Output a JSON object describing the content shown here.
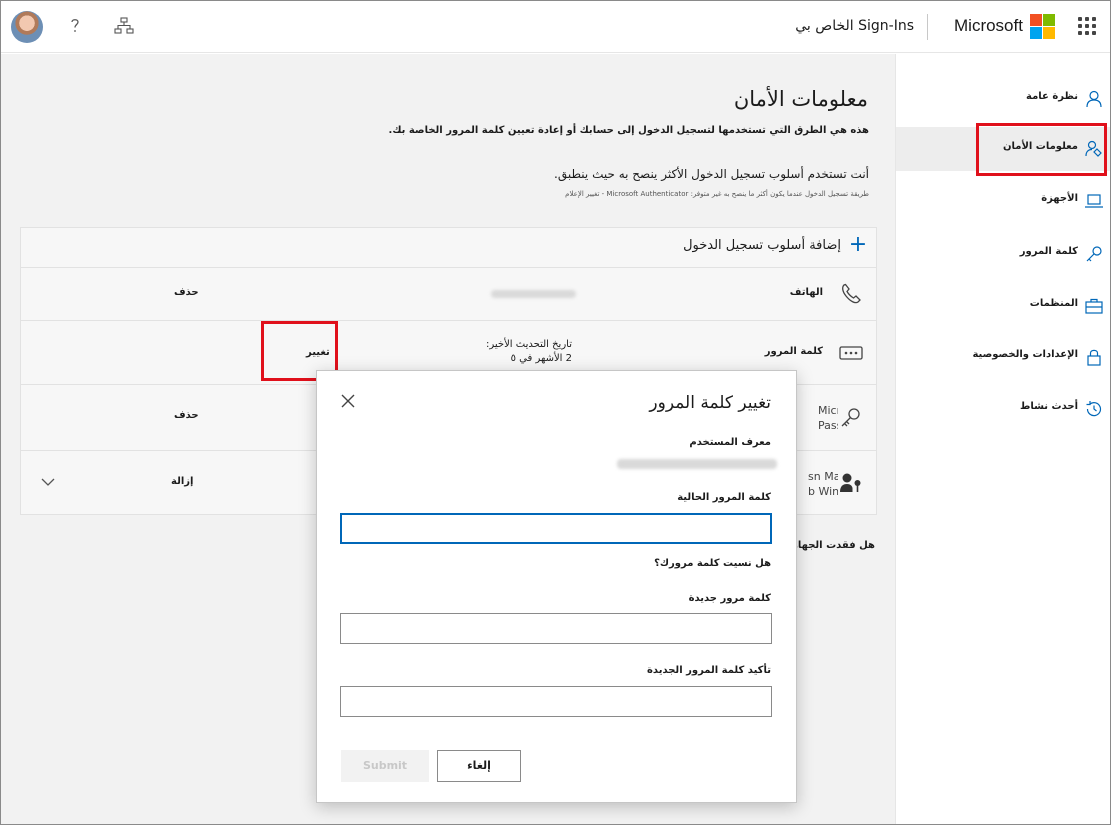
{
  "header": {
    "title": "Sign-Ins الخاص بي",
    "brand": "Microsoft",
    "icons": [
      "avatar",
      "help-icon",
      "org-chart-icon",
      "app-launcher-icon"
    ],
    "logo_colors": [
      "#f25022",
      "#7fba00",
      "#00a4ef",
      "#ffb900"
    ]
  },
  "sidebar": {
    "items": [
      {
        "label": "نظرة عامة",
        "icon": "person-icon",
        "active": false
      },
      {
        "label": "معلومات الأمان",
        "icon": "security-info-icon",
        "active": true
      },
      {
        "label": "الأجهزة",
        "icon": "laptop-icon",
        "active": false
      },
      {
        "label": "كلمة المرور",
        "icon": "key-icon",
        "active": false
      },
      {
        "label": "المنظمات",
        "icon": "briefcase-icon",
        "active": false
      },
      {
        "label": "الإعدادات والخصوصية",
        "icon": "lock-icon",
        "active": false
      },
      {
        "label": "أحدث نشاط",
        "icon": "history-icon",
        "active": false
      }
    ]
  },
  "main": {
    "title": "معلومات الأمان",
    "description": "هذه هي الطرق التي تستخدمها لتسجيل الدخول إلى حسابك أو إعادة تعيين كلمة المرور الخاصة بك.",
    "subtitle": "أنت تستخدم أسلوب تسجيل الدخول الأكثر ينصح به حيث ينطبق.",
    "small_note": "طريقة تسجيل الدخول عندما يكون أكثر ما ينصح به غير متوفر: Microsoft Authenticator - تغيير الإعلام",
    "add_method": "إضافة أسلوب تسجيل الدخول",
    "methods": [
      {
        "icon": "phone-icon",
        "label": "الهاتف",
        "action": "حذف"
      },
      {
        "icon": "password-dots-icon",
        "label": "كلمة المرور",
        "last_updated_label": "تاريخ التحديث الأخير:",
        "last_updated_value": "2 الأشهر في ٥",
        "action": "تغيير"
      },
      {
        "icon": "authenticator-icon",
        "label_partial_1": "Micro",
        "label_partial_2": "Passv",
        "action": "حذف"
      },
      {
        "icon": "person-key-icon",
        "label_partial_1": "sn Ma",
        "label_partial_2": "b Win",
        "action": "إزالة"
      }
    ],
    "lost_device": "هل فقدت الجهاز؟"
  },
  "dialog": {
    "title": "تغيير كلمة المرور",
    "user_id_label": "معرف المستخدم",
    "current_password_label": "كلمة المرور الحالية",
    "current_password_value": "",
    "forgot_link": "هل نسيت كلمة مرورك؟",
    "new_password_label": "كلمة مرور جديدة",
    "new_password_value": "",
    "confirm_password_label": "تأكيد كلمة المرور الجديدة",
    "confirm_password_value": "",
    "submit_label": "Submit",
    "cancel_label": "إلغاء"
  }
}
